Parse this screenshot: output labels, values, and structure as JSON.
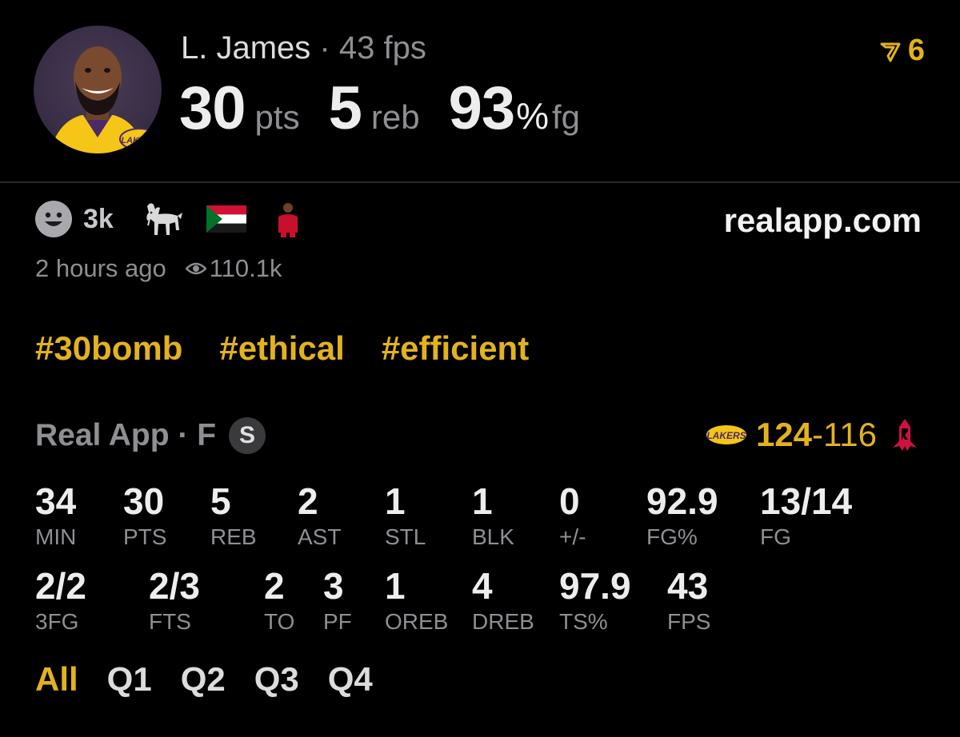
{
  "header": {
    "player_name": "L. James",
    "separator": "·",
    "fps_label": "43 fps",
    "pts_value": "30",
    "pts_unit": "pts",
    "reb_value": "5",
    "reb_unit": "reb",
    "fg_value": "93",
    "fg_pct": "%",
    "fg_unit": "fg",
    "corner_count": "6",
    "corner_icon": "flag-ribbon-icon",
    "avatar_team_badge": "LAKERS"
  },
  "reactions": {
    "smiley_count": "3k",
    "items": [
      "smiley-icon",
      "goat-icon",
      "sudan-flag-icon",
      "player-icon"
    ],
    "site": "realapp.com",
    "time_ago": "2 hours ago",
    "views": "110.1k"
  },
  "hashtags": [
    "#30bomb",
    "#ethical",
    "#efficient"
  ],
  "game": {
    "source": "Real App · F",
    "badge": "S",
    "home_score": "124",
    "dash": "-",
    "away_score": "116",
    "home_logo": "LAKERS",
    "away_logo": "rockets-logo"
  },
  "stats_row1": [
    {
      "value": "34",
      "label": "MIN"
    },
    {
      "value": "30",
      "label": "PTS"
    },
    {
      "value": "5",
      "label": "REB"
    },
    {
      "value": "2",
      "label": "AST"
    },
    {
      "value": "1",
      "label": "STL"
    },
    {
      "value": "1",
      "label": "BLK"
    },
    {
      "value": "0",
      "label": "+/-"
    },
    {
      "value": "92.9",
      "label": "FG%"
    },
    {
      "value": "13/14",
      "label": "FG"
    }
  ],
  "stats_row2": [
    {
      "value": "2/2",
      "label": "3FG"
    },
    {
      "value": "2/3",
      "label": "FTS"
    },
    {
      "value": "2",
      "label": "TO"
    },
    {
      "value": "3",
      "label": "PF"
    },
    {
      "value": "1",
      "label": "OREB"
    },
    {
      "value": "4",
      "label": "DREB"
    },
    {
      "value": "97.9",
      "label": "TS%"
    },
    {
      "value": "43",
      "label": "FPS"
    }
  ],
  "quarters": [
    "All",
    "Q1",
    "Q2",
    "Q3",
    "Q4"
  ],
  "colors": {
    "accent": "#e3b21d",
    "muted": "#8e8e93",
    "background": "#000000"
  }
}
